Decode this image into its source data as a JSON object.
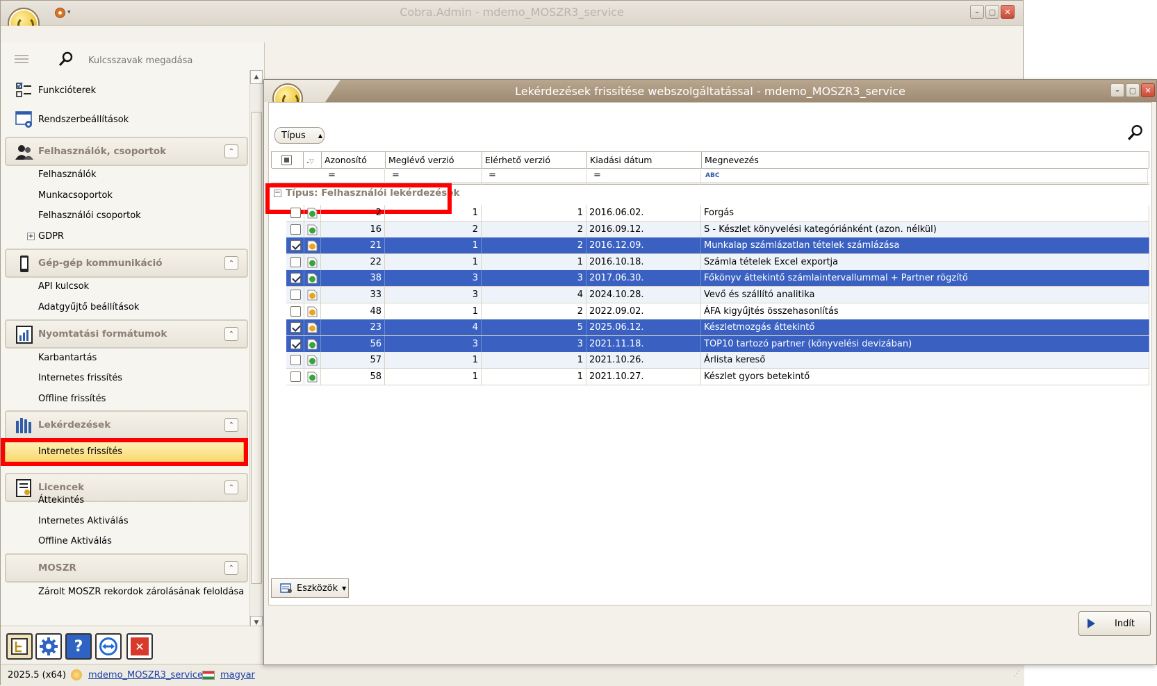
{
  "main_window": {
    "title": "Cobra.Admin - mdemo_MOSZR3_service",
    "minimize": "–",
    "maximize": "▢",
    "close": "✕"
  },
  "sidebar": {
    "search_placeholder": "Kulcsszavak megadása",
    "top_items": [
      {
        "label": "Funkcióterek",
        "icon": "function-spaces-icon"
      },
      {
        "label": "Rendszerbeállítások",
        "icon": "system-settings-icon"
      }
    ],
    "groups": [
      {
        "label": "Felhasználók, csoportok",
        "items": [
          "Felhasználók",
          "Munkacsoportok",
          "Felhasználói csoportok",
          "GDPR"
        ]
      },
      {
        "label": "Gép-gép kommunikáció",
        "items": [
          "API kulcsok",
          "Adatgyűjtő beállítások"
        ]
      },
      {
        "label": "Nyomtatási formátumok",
        "items": [
          "Karbantartás",
          "Internetes frissítés",
          "Offline frissítés"
        ]
      },
      {
        "label": "Lekérdezések",
        "items": [
          "Internetes frissítés"
        ]
      },
      {
        "label": "Licencek",
        "items": [
          "Áttekintés",
          "Internetes Aktiválás",
          "Offline Aktiválás"
        ]
      },
      {
        "label": "MOSZR",
        "items": [
          "Zárolt MOSZR rekordok zárolásának feloldása"
        ]
      }
    ],
    "gdpr_expand": "+",
    "collapse_glyph": "⌃",
    "selected_item": "Internetes frissítés"
  },
  "statusbar": {
    "version": "2025.5 (x64)",
    "database": "mdemo_MOSZR3_service",
    "language": "magyar"
  },
  "dialog": {
    "title": "Lekérdezések frissítése webszolgáltatással - mdemo_MOSZR3_service",
    "type_button": "Típus",
    "columns": [
      ".",
      "Azonosító",
      "Meglévő verzió",
      "Elérhető verzió",
      "Kiadási dátum",
      "Megnevezés"
    ],
    "filters": [
      "=",
      "=",
      "=",
      "=",
      "ABC"
    ],
    "group_label": "Típus: Felhasználói lekérdezések",
    "rows": [
      {
        "checked": false,
        "selected": false,
        "status": "ok",
        "id": "2",
        "current": "1",
        "available": "1",
        "date": "2016.06.02.",
        "name": "Forgás"
      },
      {
        "checked": false,
        "selected": false,
        "status": "ok",
        "id": "16",
        "current": "2",
        "available": "2",
        "date": "2016.09.12.",
        "name": "S - Készlet könyvelési kategóriánként (azon. nélkül)"
      },
      {
        "checked": true,
        "selected": true,
        "status": "update",
        "id": "21",
        "current": "1",
        "available": "2",
        "date": "2016.12.09.",
        "name": "Munkalap számlázatlan tételek számlázása"
      },
      {
        "checked": false,
        "selected": false,
        "status": "ok",
        "id": "22",
        "current": "1",
        "available": "1",
        "date": "2016.10.18.",
        "name": "Számla tételek Excel exportja"
      },
      {
        "checked": true,
        "selected": true,
        "status": "ok",
        "id": "38",
        "current": "3",
        "available": "3",
        "date": "2017.06.30.",
        "name": "Főkönyv áttekintő számlaintervallummal + Partner rögzítő"
      },
      {
        "checked": false,
        "selected": false,
        "status": "update",
        "id": "33",
        "current": "3",
        "available": "4",
        "date": "2024.10.28.",
        "name": "Vevő és szállító analitika"
      },
      {
        "checked": false,
        "selected": false,
        "status": "update",
        "id": "48",
        "current": "1",
        "available": "2",
        "date": "2022.09.02.",
        "name": "ÁFA kigyűjtés összehasonlítás"
      },
      {
        "checked": true,
        "selected": true,
        "status": "update",
        "id": "23",
        "current": "4",
        "available": "5",
        "date": "2025.06.12.",
        "name": "Készletmozgás áttekintő"
      },
      {
        "checked": true,
        "selected": true,
        "status": "ok",
        "id": "56",
        "current": "3",
        "available": "3",
        "date": "2021.11.18.",
        "name": "TOP10 tartozó partner (könyvelési devizában)"
      },
      {
        "checked": false,
        "selected": false,
        "status": "ok",
        "id": "57",
        "current": "1",
        "available": "1",
        "date": "2021.10.26.",
        "name": "Árlista kereső"
      },
      {
        "checked": false,
        "selected": false,
        "status": "ok",
        "id": "58",
        "current": "1",
        "available": "1",
        "date": "2021.10.27.",
        "name": "Készlet gyors betekintő"
      }
    ],
    "tools_button": "Eszközök",
    "start_button": "Indít"
  },
  "colors": {
    "selection": "#3a61c2",
    "highlight": "#ff0000",
    "group_text": "#8b7f73",
    "link": "#1a3fa8"
  }
}
